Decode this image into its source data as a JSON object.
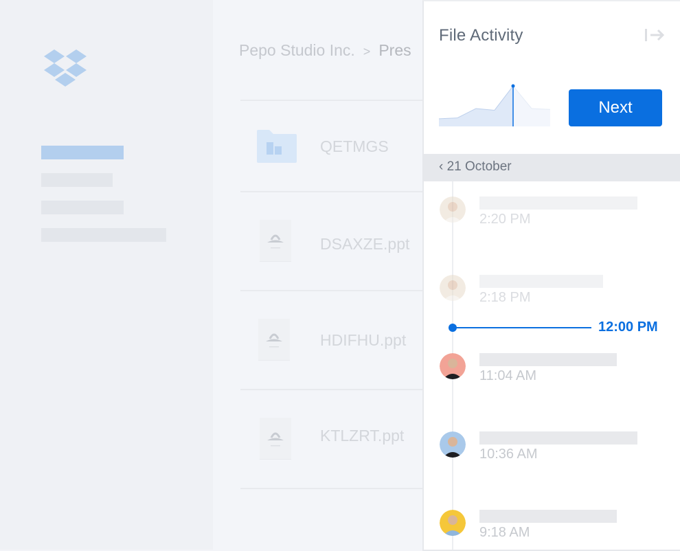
{
  "sidebar": {
    "logo": "dropbox-logo",
    "nav_items": [
      {
        "state": "active"
      },
      {
        "state": "placeholder"
      },
      {
        "state": "placeholder"
      },
      {
        "state": "placeholder"
      }
    ]
  },
  "main": {
    "breadcrumb": {
      "root": "Pepo Studio Inc.",
      "separator": ">",
      "current": "Pres"
    },
    "files": [
      {
        "name": "QETMGS",
        "type": "folder",
        "icon": "shared-folder-icon"
      },
      {
        "name": "DSAXZE.ppt",
        "type": "ppt",
        "icon": "presentation-icon"
      },
      {
        "name": "HDIFHU.ppt",
        "type": "ppt",
        "icon": "presentation-icon"
      },
      {
        "name": "KTLZRT.ppt",
        "type": "ppt",
        "icon": "presentation-icon"
      }
    ]
  },
  "panel": {
    "title": "File Activity",
    "collapse_icon": "collapse-right-icon",
    "next_label": "Next",
    "date_label": "21 October",
    "now_label": "12:00 PM",
    "accent_color": "#0a6fe0",
    "entries": [
      {
        "time": "2:20 PM",
        "avatar_bg": "#e8dccb",
        "state": "faded"
      },
      {
        "time": "2:18 PM",
        "avatar_bg": "#e8dccb",
        "state": "faded"
      },
      {
        "time": "11:04 AM",
        "avatar_bg": "#f2a396",
        "state": "normal"
      },
      {
        "time": "10:36 AM",
        "avatar_bg": "#a9c9ea",
        "state": "normal"
      },
      {
        "time": "9:18 AM",
        "avatar_bg": "#f5c73a",
        "state": "normal"
      }
    ]
  },
  "chart_data": {
    "type": "area",
    "title": "",
    "x": [
      0,
      1,
      2,
      3,
      4,
      5,
      6
    ],
    "values": [
      0.18,
      0.2,
      0.42,
      0.38,
      0.95,
      0.42,
      0.4
    ],
    "selected_index": 4,
    "ylim": [
      0,
      1
    ],
    "grid": false
  }
}
